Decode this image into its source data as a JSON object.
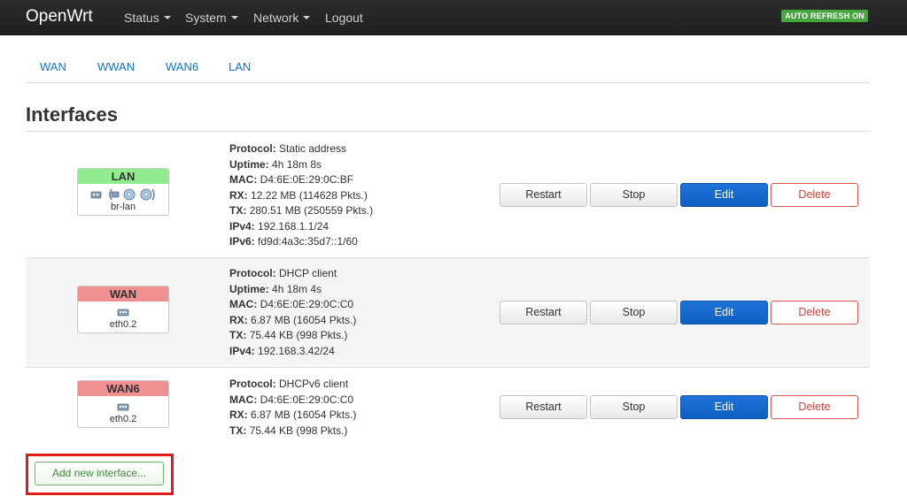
{
  "navbar": {
    "brand": "OpenWrt",
    "items": [
      {
        "label": "Status",
        "dropdown": true
      },
      {
        "label": "System",
        "dropdown": true
      },
      {
        "label": "Network",
        "dropdown": true
      },
      {
        "label": "Logout",
        "dropdown": false
      }
    ],
    "auto_refresh_badge": "AUTO REFRESH ON"
  },
  "tabs": [
    "WAN",
    "WWAN",
    "WAN6",
    "LAN"
  ],
  "page_title": "Interfaces",
  "colors": {
    "accent_link": "#0f73c8",
    "badge_green": "#45a53e",
    "lan_header": "#90ee90",
    "wan_header": "#f09090",
    "edit_button": "#1668cf",
    "delete_border": "#d9534f",
    "highlight_border": "#e01b1b"
  },
  "interfaces": [
    {
      "name": "LAN",
      "device": "br-lan",
      "header_color": "#90ee90",
      "icons": [
        "ethernet-port-icon",
        "bridge-icon",
        "wireless-icon",
        "wireless-icon"
      ],
      "info": [
        {
          "label": "Protocol:",
          "value": "Static address"
        },
        {
          "label": "Uptime:",
          "value": "4h 18m 8s"
        },
        {
          "label": "MAC:",
          "value": "D4:6E:0E:29:0C:BF"
        },
        {
          "label": "RX:",
          "value": "12.22 MB (114628 Pkts.)"
        },
        {
          "label": "TX:",
          "value": "280.51 MB (250559 Pkts.)"
        },
        {
          "label": "IPv4:",
          "value": "192.168.1.1/24"
        },
        {
          "label": "IPv6:",
          "value": "fd9d:4a3c:35d7::1/60"
        }
      ]
    },
    {
      "name": "WAN",
      "device": "eth0.2",
      "header_color": "#f09090",
      "icons": [
        "ethernet-port-icon"
      ],
      "info": [
        {
          "label": "Protocol:",
          "value": "DHCP client"
        },
        {
          "label": "Uptime:",
          "value": "4h 18m 4s"
        },
        {
          "label": "MAC:",
          "value": "D4:6E:0E:29:0C:C0"
        },
        {
          "label": "RX:",
          "value": "6.87 MB (16054 Pkts.)"
        },
        {
          "label": "TX:",
          "value": "75.44 KB (998 Pkts.)"
        },
        {
          "label": "IPv4:",
          "value": "192.168.3.42/24"
        }
      ]
    },
    {
      "name": "WAN6",
      "device": "eth0.2",
      "header_color": "#f09090",
      "icons": [
        "ethernet-port-icon"
      ],
      "info": [
        {
          "label": "Protocol:",
          "value": "DHCPv6 client"
        },
        {
          "label": "MAC:",
          "value": "D4:6E:0E:29:0C:C0"
        },
        {
          "label": "RX:",
          "value": "6.87 MB (16054 Pkts.)"
        },
        {
          "label": "TX:",
          "value": "75.44 KB (998 Pkts.)"
        }
      ]
    }
  ],
  "buttons": {
    "restart": "Restart",
    "stop": "Stop",
    "edit": "Edit",
    "delete": "Delete"
  },
  "add_button": "Add new interface..."
}
